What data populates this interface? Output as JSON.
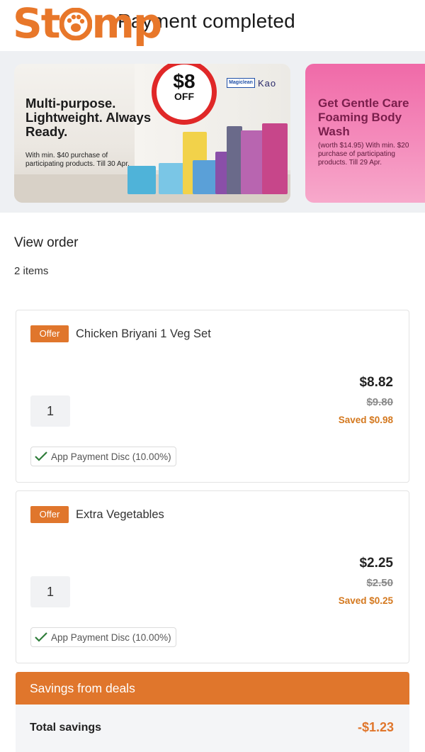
{
  "header": {
    "title": "Payment completed",
    "logo_text": "Stomp"
  },
  "banners": [
    {
      "badge_amount": "$8",
      "badge_label": "OFF",
      "brand_1": "Magiclean",
      "brand_2": "Kao",
      "headline": "Multi-purpose. Lightweight. Always Ready.",
      "subtext": "With min. $40 purchase of participating products. Till 30 Apr."
    },
    {
      "headline": "Get Gentle Care Foaming Body Wash",
      "subtext": "(worth $14.95) With min. $20 purchase of participating products. Till 29 Apr."
    }
  ],
  "order": {
    "section_title": "View order",
    "item_count": "2 items",
    "items": [
      {
        "tag": "Offer",
        "name": "Chicken Briyani 1 Veg Set",
        "quantity": "1",
        "price": "$8.82",
        "original_price": "$9.80",
        "saved": "Saved $0.98",
        "discount": "App Payment Disc (10.00%)"
      },
      {
        "tag": "Offer",
        "name": "Extra Vegetables",
        "quantity": "1",
        "price": "$2.25",
        "original_price": "$2.50",
        "saved": "Saved $0.25",
        "discount": "App Payment Disc (10.00%)"
      }
    ]
  },
  "savings": {
    "header": "Savings from deals",
    "total_label": "Total savings",
    "total_value": "-$1.23"
  },
  "colors": {
    "accent": "#e0762c",
    "badge_red": "#e02828",
    "banner2_pink": "#f06aa8"
  }
}
